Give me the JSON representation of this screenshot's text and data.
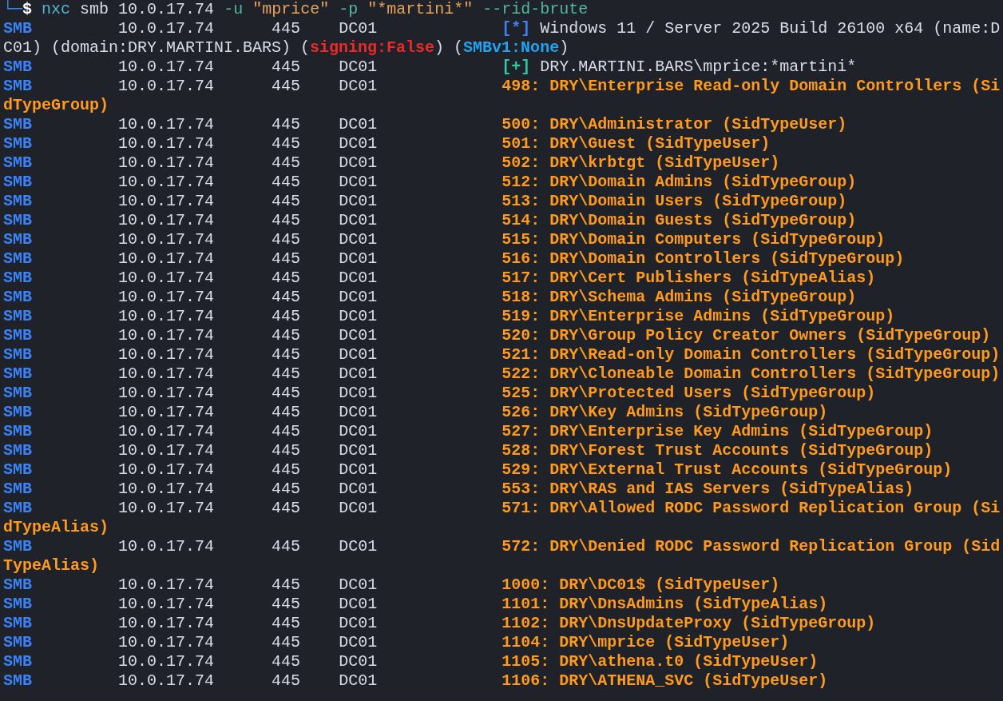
{
  "prompt": {
    "branch": "└─",
    "symbol": "$"
  },
  "command": [
    {
      "kind": "program",
      "text": "nxc"
    },
    {
      "kind": "plain",
      "text": "smb 10.0.17.74"
    },
    {
      "kind": "option",
      "text": "-u"
    },
    {
      "kind": "string",
      "text": "\"mprice\""
    },
    {
      "kind": "option",
      "text": "-p"
    },
    {
      "kind": "string",
      "text": "\"*martini*\""
    },
    {
      "kind": "option",
      "text": "--rid-brute"
    }
  ],
  "rows": [
    {
      "protocol": "SMB",
      "host": "10.0.17.74",
      "port": "445",
      "name": "DC01",
      "kind": "info",
      "marker": "[*]",
      "segments": [
        {
          "kind": "plain",
          "text": "Windows 11 / Server 2025 Build 26100 x64 (name:D"
        }
      ],
      "wrapped": [
        {
          "kind": "plain",
          "text": "C01) (domain:DRY.MARTINI.BARS) ("
        },
        {
          "kind": "alert",
          "text": "signing:False"
        },
        {
          "kind": "plain",
          "text": ") ("
        },
        {
          "kind": "note",
          "text": "SMBv1:None"
        },
        {
          "kind": "plain",
          "text": ")"
        }
      ]
    },
    {
      "protocol": "SMB",
      "host": "10.0.17.74",
      "port": "445",
      "name": "DC01",
      "kind": "success",
      "marker": "[+]",
      "segments": [
        {
          "kind": "plain",
          "text": "DRY.MARTINI.BARS\\mprice:*martini*"
        }
      ]
    },
    {
      "protocol": "SMB",
      "host": "10.0.17.74",
      "port": "445",
      "name": "DC01",
      "kind": "entry",
      "segments": [
        {
          "kind": "entry",
          "text": "498: DRY\\Enterprise Read-only Domain Controllers (Si"
        }
      ],
      "wrapped": [
        {
          "kind": "entry",
          "text": "dTypeGroup)"
        }
      ]
    },
    {
      "protocol": "SMB",
      "host": "10.0.17.74",
      "port": "445",
      "name": "DC01",
      "kind": "entry",
      "segments": [
        {
          "kind": "entry",
          "text": "500: DRY\\Administrator (SidTypeUser)"
        }
      ]
    },
    {
      "protocol": "SMB",
      "host": "10.0.17.74",
      "port": "445",
      "name": "DC01",
      "kind": "entry",
      "segments": [
        {
          "kind": "entry",
          "text": "501: DRY\\Guest (SidTypeUser)"
        }
      ]
    },
    {
      "protocol": "SMB",
      "host": "10.0.17.74",
      "port": "445",
      "name": "DC01",
      "kind": "entry",
      "segments": [
        {
          "kind": "entry",
          "text": "502: DRY\\krbtgt (SidTypeUser)"
        }
      ]
    },
    {
      "protocol": "SMB",
      "host": "10.0.17.74",
      "port": "445",
      "name": "DC01",
      "kind": "entry",
      "segments": [
        {
          "kind": "entry",
          "text": "512: DRY\\Domain Admins (SidTypeGroup)"
        }
      ]
    },
    {
      "protocol": "SMB",
      "host": "10.0.17.74",
      "port": "445",
      "name": "DC01",
      "kind": "entry",
      "segments": [
        {
          "kind": "entry",
          "text": "513: DRY\\Domain Users (SidTypeGroup)"
        }
      ]
    },
    {
      "protocol": "SMB",
      "host": "10.0.17.74",
      "port": "445",
      "name": "DC01",
      "kind": "entry",
      "segments": [
        {
          "kind": "entry",
          "text": "514: DRY\\Domain Guests (SidTypeGroup)"
        }
      ]
    },
    {
      "protocol": "SMB",
      "host": "10.0.17.74",
      "port": "445",
      "name": "DC01",
      "kind": "entry",
      "segments": [
        {
          "kind": "entry",
          "text": "515: DRY\\Domain Computers (SidTypeGroup)"
        }
      ]
    },
    {
      "protocol": "SMB",
      "host": "10.0.17.74",
      "port": "445",
      "name": "DC01",
      "kind": "entry",
      "segments": [
        {
          "kind": "entry",
          "text": "516: DRY\\Domain Controllers (SidTypeGroup)"
        }
      ]
    },
    {
      "protocol": "SMB",
      "host": "10.0.17.74",
      "port": "445",
      "name": "DC01",
      "kind": "entry",
      "segments": [
        {
          "kind": "entry",
          "text": "517: DRY\\Cert Publishers (SidTypeAlias)"
        }
      ]
    },
    {
      "protocol": "SMB",
      "host": "10.0.17.74",
      "port": "445",
      "name": "DC01",
      "kind": "entry",
      "segments": [
        {
          "kind": "entry",
          "text": "518: DRY\\Schema Admins (SidTypeGroup)"
        }
      ]
    },
    {
      "protocol": "SMB",
      "host": "10.0.17.74",
      "port": "445",
      "name": "DC01",
      "kind": "entry",
      "segments": [
        {
          "kind": "entry",
          "text": "519: DRY\\Enterprise Admins (SidTypeGroup)"
        }
      ]
    },
    {
      "protocol": "SMB",
      "host": "10.0.17.74",
      "port": "445",
      "name": "DC01",
      "kind": "entry",
      "segments": [
        {
          "kind": "entry",
          "text": "520: DRY\\Group Policy Creator Owners (SidTypeGroup)"
        }
      ]
    },
    {
      "protocol": "SMB",
      "host": "10.0.17.74",
      "port": "445",
      "name": "DC01",
      "kind": "entry",
      "segments": [
        {
          "kind": "entry",
          "text": "521: DRY\\Read-only Domain Controllers (SidTypeGroup)"
        }
      ]
    },
    {
      "protocol": "SMB",
      "host": "10.0.17.74",
      "port": "445",
      "name": "DC01",
      "kind": "entry",
      "segments": [
        {
          "kind": "entry",
          "text": "522: DRY\\Cloneable Domain Controllers (SidTypeGroup)"
        }
      ]
    },
    {
      "protocol": "SMB",
      "host": "10.0.17.74",
      "port": "445",
      "name": "DC01",
      "kind": "entry",
      "segments": [
        {
          "kind": "entry",
          "text": "525: DRY\\Protected Users (SidTypeGroup)"
        }
      ]
    },
    {
      "protocol": "SMB",
      "host": "10.0.17.74",
      "port": "445",
      "name": "DC01",
      "kind": "entry",
      "segments": [
        {
          "kind": "entry",
          "text": "526: DRY\\Key Admins (SidTypeGroup)"
        }
      ]
    },
    {
      "protocol": "SMB",
      "host": "10.0.17.74",
      "port": "445",
      "name": "DC01",
      "kind": "entry",
      "segments": [
        {
          "kind": "entry",
          "text": "527: DRY\\Enterprise Key Admins (SidTypeGroup)"
        }
      ]
    },
    {
      "protocol": "SMB",
      "host": "10.0.17.74",
      "port": "445",
      "name": "DC01",
      "kind": "entry",
      "segments": [
        {
          "kind": "entry",
          "text": "528: DRY\\Forest Trust Accounts (SidTypeGroup)"
        }
      ]
    },
    {
      "protocol": "SMB",
      "host": "10.0.17.74",
      "port": "445",
      "name": "DC01",
      "kind": "entry",
      "segments": [
        {
          "kind": "entry",
          "text": "529: DRY\\External Trust Accounts (SidTypeGroup)"
        }
      ]
    },
    {
      "protocol": "SMB",
      "host": "10.0.17.74",
      "port": "445",
      "name": "DC01",
      "kind": "entry",
      "segments": [
        {
          "kind": "entry",
          "text": "553: DRY\\RAS and IAS Servers (SidTypeAlias)"
        }
      ]
    },
    {
      "protocol": "SMB",
      "host": "10.0.17.74",
      "port": "445",
      "name": "DC01",
      "kind": "entry",
      "segments": [
        {
          "kind": "entry",
          "text": "571: DRY\\Allowed RODC Password Replication Group (Si"
        }
      ],
      "wrapped": [
        {
          "kind": "entry",
          "text": "dTypeAlias)"
        }
      ]
    },
    {
      "protocol": "SMB",
      "host": "10.0.17.74",
      "port": "445",
      "name": "DC01",
      "kind": "entry",
      "segments": [
        {
          "kind": "entry",
          "text": "572: DRY\\Denied RODC Password Replication Group (Sid"
        }
      ],
      "wrapped": [
        {
          "kind": "entry",
          "text": "TypeAlias)"
        }
      ]
    },
    {
      "protocol": "SMB",
      "host": "10.0.17.74",
      "port": "445",
      "name": "DC01",
      "kind": "entry",
      "segments": [
        {
          "kind": "entry",
          "text": "1000: DRY\\DC01$ (SidTypeUser)"
        }
      ]
    },
    {
      "protocol": "SMB",
      "host": "10.0.17.74",
      "port": "445",
      "name": "DC01",
      "kind": "entry",
      "segments": [
        {
          "kind": "entry",
          "text": "1101: DRY\\DnsAdmins (SidTypeAlias)"
        }
      ]
    },
    {
      "protocol": "SMB",
      "host": "10.0.17.74",
      "port": "445",
      "name": "DC01",
      "kind": "entry",
      "segments": [
        {
          "kind": "entry",
          "text": "1102: DRY\\DnsUpdateProxy (SidTypeGroup)"
        }
      ]
    },
    {
      "protocol": "SMB",
      "host": "10.0.17.74",
      "port": "445",
      "name": "DC01",
      "kind": "entry",
      "segments": [
        {
          "kind": "entry",
          "text": "1104: DRY\\mprice (SidTypeUser)"
        }
      ]
    },
    {
      "protocol": "SMB",
      "host": "10.0.17.74",
      "port": "445",
      "name": "DC01",
      "kind": "entry",
      "segments": [
        {
          "kind": "entry",
          "text": "1105: DRY\\athena.t0 (SidTypeUser)"
        }
      ]
    },
    {
      "protocol": "SMB",
      "host": "10.0.17.74",
      "port": "445",
      "name": "DC01",
      "kind": "entry",
      "segments": [
        {
          "kind": "entry",
          "text": "1106: DRY\\ATHENA_SVC (SidTypeUser)"
        }
      ]
    }
  ]
}
